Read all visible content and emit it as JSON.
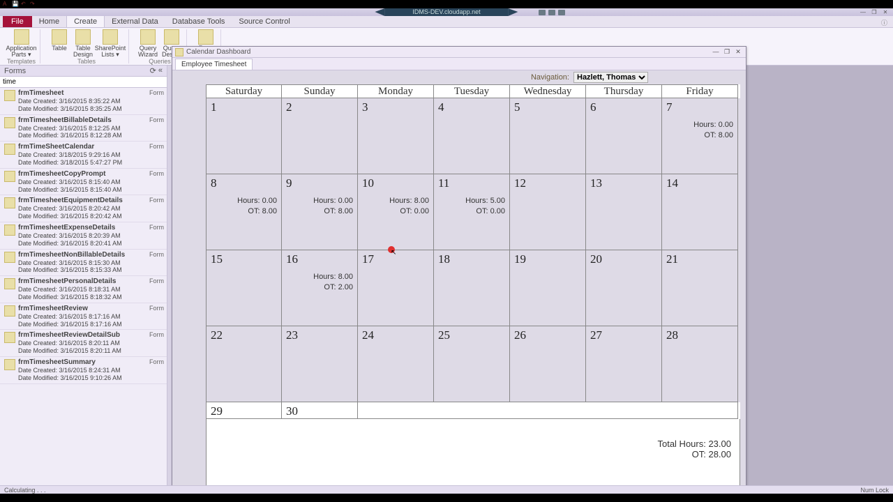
{
  "titlebar": {
    "app_title": "IDMS-DEV.cloudapp.net"
  },
  "ribbon": {
    "file": "File",
    "tabs": [
      "Home",
      "Create",
      "External Data",
      "Database Tools",
      "Source Control"
    ],
    "groups": {
      "templates": {
        "btn": "Application\nParts ▾",
        "cap": "Templates"
      },
      "tables": {
        "b1": "Table",
        "b2": "Table\nDesign",
        "b3": "SharePoint\nLists ▾",
        "cap": "Tables"
      },
      "queries": {
        "b1": "Query\nWizard",
        "b2": "Query\nDesign",
        "cap": "Queries"
      },
      "forms": {
        "b1": "Form"
      }
    }
  },
  "nav": {
    "header": "Forms",
    "search_value": "time",
    "items": [
      {
        "nm": "frmTimesheet",
        "type": "Form",
        "c": "Date Created: 3/16/2015 8:35:22 AM",
        "m": "Date Modified: 3/16/2015 8:35:25 AM"
      },
      {
        "nm": "frmTimesheetBillableDetails",
        "type": "Form",
        "c": "Date Created: 3/16/2015 8:12:25 AM",
        "m": "Date Modified: 3/16/2015 8:12:28 AM"
      },
      {
        "nm": "frmTimeSheetCalendar",
        "type": "Form",
        "c": "Date Created: 3/18/2015 9:29:16 AM",
        "m": "Date Modified: 3/18/2015 5:47:27 PM"
      },
      {
        "nm": "frmTimesheetCopyPrompt",
        "type": "Form",
        "c": "Date Created: 3/16/2015 8:15:40 AM",
        "m": "Date Modified: 3/16/2015 8:15:40 AM"
      },
      {
        "nm": "frmTimesheetEquipmentDetails",
        "type": "Form",
        "c": "Date Created: 3/16/2015 8:20:42 AM",
        "m": "Date Modified: 3/16/2015 8:20:42 AM"
      },
      {
        "nm": "frmTimesheetExpenseDetails",
        "type": "Form",
        "c": "Date Created: 3/16/2015 8:20:39 AM",
        "m": "Date Modified: 3/16/2015 8:20:41 AM"
      },
      {
        "nm": "frmTimesheetNonBillableDetails",
        "type": "Form",
        "c": "Date Created: 3/16/2015 8:15:30 AM",
        "m": "Date Modified: 3/16/2015 8:15:33 AM"
      },
      {
        "nm": "frmTimesheetPersonalDetails",
        "type": "Form",
        "c": "Date Created: 3/16/2015 8:18:31 AM",
        "m": "Date Modified: 3/16/2015 8:18:32 AM"
      },
      {
        "nm": "frmTimesheetReview",
        "type": "Form",
        "c": "Date Created: 3/16/2015 8:17:16 AM",
        "m": "Date Modified: 3/16/2015 8:17:16 AM"
      },
      {
        "nm": "frmTimesheetReviewDetailSub",
        "type": "Form",
        "c": "Date Created: 3/16/2015 8:20:11 AM",
        "m": "Date Modified: 3/16/2015 8:20:11 AM"
      },
      {
        "nm": "frmTimesheetSummary",
        "type": "Form",
        "c": "Date Created: 3/16/2015 8:24:31 AM",
        "m": "Date Modified: 3/16/2015 9:10:26 AM"
      }
    ]
  },
  "subwin": {
    "title": "Calendar Dashboard",
    "tab": "Employee Timesheet",
    "nav_label": "Navigation:",
    "nav_value": "Hazlett, Thomas"
  },
  "cal": {
    "days": [
      "Saturday",
      "Sunday",
      "Monday",
      "Tuesday",
      "Wednesday",
      "Thursday",
      "Friday"
    ],
    "weeks": [
      [
        {
          "n": "1"
        },
        {
          "n": "2"
        },
        {
          "n": "3"
        },
        {
          "n": "4"
        },
        {
          "n": "5"
        },
        {
          "n": "6"
        },
        {
          "n": "7",
          "h": "Hours: 0.00",
          "o": "OT: 8.00"
        }
      ],
      [
        {
          "n": "8",
          "h": "Hours: 0.00",
          "o": "OT: 8.00"
        },
        {
          "n": "9",
          "h": "Hours: 0.00",
          "o": "OT: 8.00"
        },
        {
          "n": "10",
          "h": "Hours: 8.00",
          "o": "OT: 0.00"
        },
        {
          "n": "11",
          "h": "Hours: 5.00",
          "o": "OT: 0.00"
        },
        {
          "n": "12"
        },
        {
          "n": "13"
        },
        {
          "n": "14"
        }
      ],
      [
        {
          "n": "15"
        },
        {
          "n": "16",
          "h": "Hours: 8.00",
          "o": "OT: 2.00"
        },
        {
          "n": "17"
        },
        {
          "n": "18"
        },
        {
          "n": "19"
        },
        {
          "n": "20"
        },
        {
          "n": "21"
        }
      ],
      [
        {
          "n": "22"
        },
        {
          "n": "23"
        },
        {
          "n": "24"
        },
        {
          "n": "25"
        },
        {
          "n": "26"
        },
        {
          "n": "27"
        },
        {
          "n": "28"
        }
      ]
    ],
    "last": [
      {
        "n": "29"
      },
      {
        "n": "30"
      }
    ],
    "total_h": "Total Hours: 23.00",
    "total_o": "OT: 28.00"
  },
  "status": {
    "left": "Calculating . . .",
    "right": "Num Lock"
  }
}
